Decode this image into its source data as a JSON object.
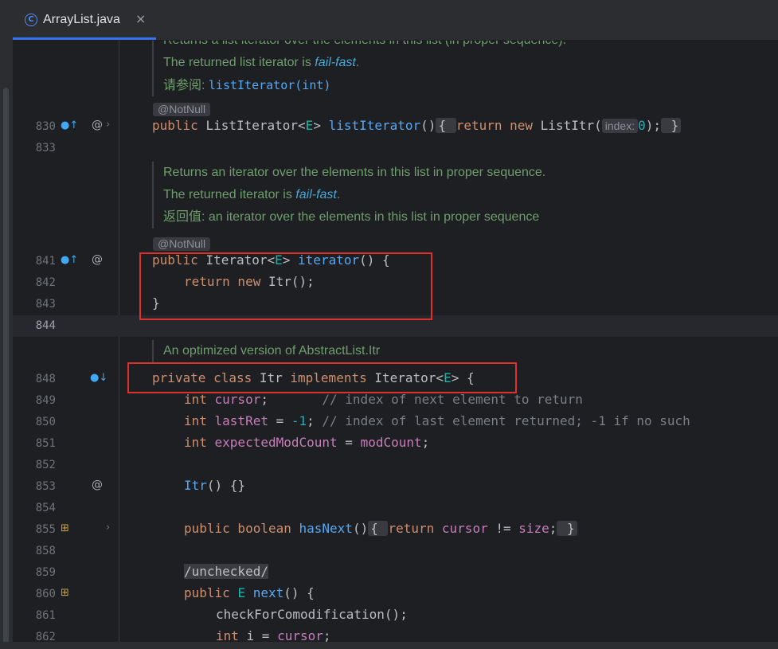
{
  "tab": {
    "icon": "class-icon",
    "icon_glyph": "C",
    "title": "ArrayList.java",
    "close_glyph": "×"
  },
  "doc1": {
    "line1": "Returns a list iterator over the elements in this list (in proper sequence).",
    "line2_pre": "The returned list iterator is ",
    "line2_em": "fail-fast",
    "line2_post": ".",
    "see_label": "请参阅: ",
    "see_link": "listIterator(int)"
  },
  "annot1": "@NotNull",
  "doc2": {
    "line1": "Returns an iterator over the elements in this list in proper sequence.",
    "line2_pre": "The returned iterator is ",
    "line2_em": "fail-fast",
    "line2_post": ".",
    "ret_label": "返回值: ",
    "ret_text": "an iterator over the elements in this list in proper sequence"
  },
  "annot2": "@NotNull",
  "doc3": {
    "line1": "An optimized version of AbstractList.Itr"
  },
  "line_numbers": {
    "n830": "830",
    "n833": "833",
    "n841": "841",
    "n842": "842",
    "n843": "843",
    "n844": "844",
    "n848": "848",
    "n849": "849",
    "n850": "850",
    "n851": "851",
    "n852": "852",
    "n853": "853",
    "n854": "854",
    "n855": "855",
    "n858": "858",
    "n859": "859",
    "n860": "860",
    "n861": "861",
    "n862": "862"
  },
  "code": {
    "l830": {
      "kw": "public ",
      "type": "ListIterator<",
      "gen": "E",
      "type2": "> ",
      "fn": "listIterator",
      "paren": "()",
      "fold_open": "{ ",
      "kw2": "return new ",
      "ctor": "ListItr(",
      "hint": "index:",
      "num": "0",
      "end": ");",
      "fold_close": " }"
    },
    "l841": {
      "kw": "public ",
      "type": "Iterator<",
      "gen": "E",
      "type2": "> ",
      "fn": "iterator",
      "rest": "() {"
    },
    "l842": {
      "kw": "return new ",
      "rest": "Itr();"
    },
    "l843": {
      "rest": "}"
    },
    "l848": {
      "kw": "private class ",
      "name": "Itr ",
      "kw2": "implements ",
      "type": "Iterator<",
      "gen": "E",
      "rest": "> {"
    },
    "l849": {
      "kw": "int ",
      "field": "cursor",
      "semi": ";       ",
      "comment": "// index of next element to return"
    },
    "l850": {
      "kw": "int ",
      "field": "lastRet",
      "op": " = ",
      "num": "-1",
      "semi": "; ",
      "comment": "// index of last element returned; -1 if no such"
    },
    "l851": {
      "kw": "int ",
      "field": "expectedModCount",
      "op": " = ",
      "field2": "modCount",
      "semi": ";"
    },
    "l853": {
      "fn": "Itr",
      "rest": "() {}"
    },
    "l855": {
      "kw": "public boolean ",
      "fn": "hasNext",
      "paren": "()",
      "fold_open": "{ ",
      "kw2": "return ",
      "field": "cursor",
      "op": " != ",
      "field2": "size",
      "semi": ";",
      "fold_close": " }"
    },
    "l859": {
      "text": "/unchecked/"
    },
    "l860": {
      "kw": "public ",
      "gen": "E ",
      "fn": "next",
      "rest": "() {"
    },
    "l861": {
      "rest": "checkForComodification();"
    },
    "l862": {
      "kw": "int ",
      "var": "i",
      "op": " = ",
      "field": "cursor",
      "semi": ";"
    }
  },
  "gutter_icons": {
    "override": "override-up-icon",
    "at": "@",
    "chevron": "›",
    "implemented": "implemented-down-icon",
    "impl_method": "implementing-method-icon"
  },
  "colors": {
    "accent": "#3574f0",
    "highlight_box": "#e0302b"
  }
}
